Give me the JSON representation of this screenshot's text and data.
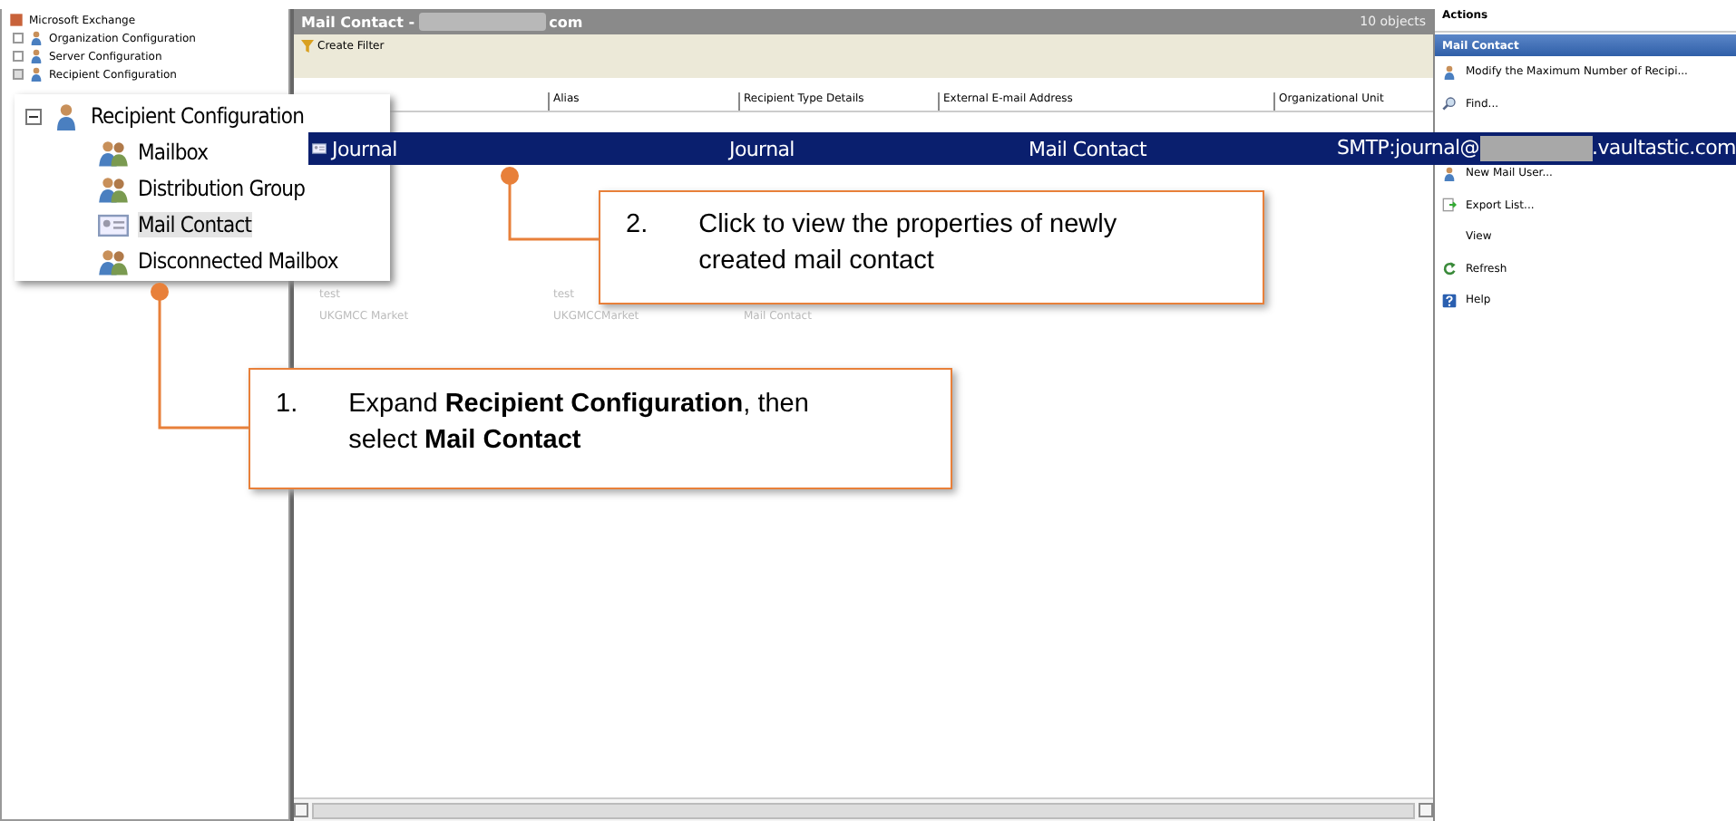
{
  "tree": [
    {
      "label": "Microsoft Exchange",
      "children": [
        {
          "label": "Organization Configuration",
          "expanded": false
        },
        {
          "label": "Server Configuration",
          "expanded": false
        },
        {
          "label": "Recipient Configuration",
          "expanded": true
        }
      ]
    }
  ],
  "tree_inset": {
    "label": "Recipient Configuration",
    "expanded": true,
    "children": [
      {
        "label": "Mailbox",
        "selected": false
      },
      {
        "label": "Distribution Group",
        "selected": false
      },
      {
        "label": "Mail Contact",
        "selected": true
      },
      {
        "label": "Disconnected Mailbox",
        "selected": false
      }
    ]
  },
  "result_pane": {
    "title": "Mail Contact - ",
    "title_suffix": "com",
    "count": "10 objects",
    "toolbar": [
      "Create Filter"
    ],
    "columns": [
      "Alias",
      "Recipient Type Details",
      "External E-mail Address",
      "Organizational Unit"
    ],
    "rows": [
      {
        "name": "test",
        "alias": "test"
      },
      {
        "name": "UKGMCC Market",
        "alias": "UKGMCCMarket",
        "type": "Mail Contact"
      }
    ]
  },
  "highlighted_row": {
    "name": "Journal",
    "alias": "Journal",
    "type": "Mail Contact",
    "address_prefix": "SMTP:journal@",
    "address_suffix": ".vaultastic.com",
    "selected": true
  },
  "actions": {
    "title": "Actions",
    "section": "Mail Contact",
    "items": [
      {
        "label": "Modify the Maximum Number of Recipi...",
        "kind": "person"
      },
      {
        "label": "Find...",
        "kind": "find"
      },
      {
        "label": "New Mail User...",
        "kind": "person"
      },
      {
        "label": "Export List...",
        "kind": "export"
      },
      {
        "label": "View",
        "kind": "none"
      },
      {
        "label": "Refresh",
        "kind": "refresh"
      },
      {
        "label": "Help",
        "kind": "help"
      }
    ]
  },
  "callouts": [
    {
      "number": "1.",
      "text": "Expand **Recipient Configuration**, then select **Mail Contact**"
    },
    {
      "number": "2.",
      "text": "Click to view the properties of newly created mail contact"
    }
  ]
}
